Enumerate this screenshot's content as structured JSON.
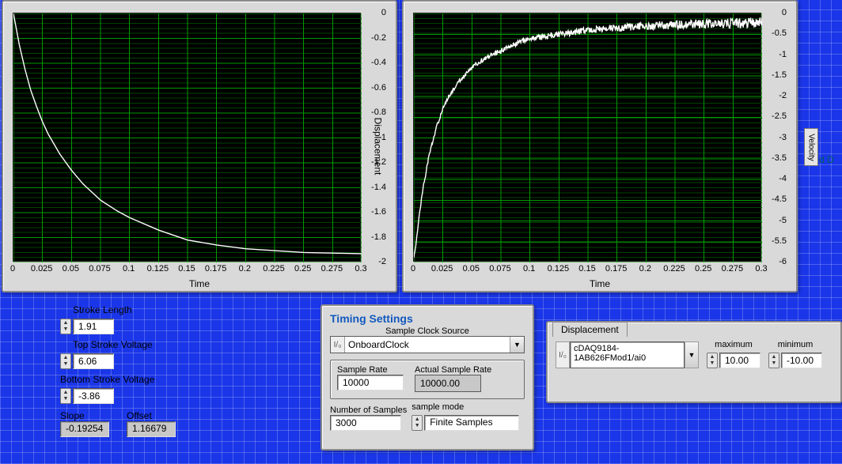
{
  "chart_data": [
    {
      "type": "line",
      "title": "",
      "xlabel": "Time",
      "ylabel": "Displacement",
      "xlim": [
        0,
        0.3
      ],
      "ylim": [
        -2,
        0
      ],
      "xticks": [
        0,
        0.025,
        0.05,
        0.075,
        0.1,
        0.125,
        0.15,
        0.175,
        0.2,
        0.225,
        0.25,
        0.275,
        0.3
      ],
      "yticks": [
        -2,
        -1.8,
        -1.6,
        -1.4,
        -1.2,
        -1,
        -0.8,
        -0.6,
        -0.4,
        -0.2,
        0
      ],
      "series": [
        {
          "name": "Displacement",
          "x": [
            0,
            0.005,
            0.01,
            0.015,
            0.02,
            0.025,
            0.03,
            0.04,
            0.05,
            0.06,
            0.075,
            0.09,
            0.1,
            0.125,
            0.15,
            0.175,
            0.2,
            0.25,
            0.3
          ],
          "y": [
            0,
            -0.25,
            -0.45,
            -0.62,
            -0.75,
            -0.87,
            -0.97,
            -1.13,
            -1.26,
            -1.37,
            -1.5,
            -1.59,
            -1.64,
            -1.74,
            -1.82,
            -1.86,
            -1.89,
            -1.92,
            -1.93
          ]
        }
      ]
    },
    {
      "type": "line",
      "title": "",
      "xlabel": "Time",
      "ylabel": "Velocity",
      "xlim": [
        0,
        0.3
      ],
      "ylim": [
        -6,
        0
      ],
      "xticks": [
        0,
        0.025,
        0.05,
        0.075,
        0.1,
        0.125,
        0.15,
        0.175,
        0.2,
        0.225,
        0.25,
        0.275,
        0.3
      ],
      "yticks": [
        -6,
        -5.5,
        -5,
        -4.5,
        -4,
        -3.5,
        -3,
        -2.5,
        -2,
        -1.5,
        -1,
        -0.5,
        0
      ],
      "series": [
        {
          "name": "Velocity",
          "x": [
            0,
            0.002,
            0.004,
            0.006,
            0.008,
            0.01,
            0.0125,
            0.015,
            0.02,
            0.025,
            0.03,
            0.04,
            0.05,
            0.06,
            0.075,
            0.09,
            0.1,
            0.125,
            0.15,
            0.175,
            0.2,
            0.25,
            0.3
          ],
          "y": [
            -5.9,
            -5.5,
            -5.0,
            -4.6,
            -4.2,
            -3.9,
            -3.5,
            -3.2,
            -2.7,
            -2.3,
            -2.0,
            -1.6,
            -1.3,
            -1.1,
            -0.9,
            -0.7,
            -0.6,
            -0.5,
            -0.4,
            -0.35,
            -0.3,
            -0.25,
            -0.22
          ],
          "noise": 0.25
        }
      ]
    }
  ],
  "controls": {
    "stroke_length_label": "Stroke Length",
    "stroke_length": "1.91",
    "top_stroke_voltage_label": "Top Stroke Voltage",
    "top_stroke_voltage": "6.06",
    "bottom_stroke_voltage_label": "Bottom Stroke Voltage",
    "bottom_stroke_voltage": "-3.86",
    "slope_label": "Slope",
    "slope": "-0.19254",
    "offset_label": "Offset",
    "offset": "1.16679"
  },
  "timing": {
    "title": "Timing Settings",
    "sample_clock_source_label": "Sample Clock Source",
    "sample_clock_source": "OnboardClock",
    "sample_rate_label": "Sample Rate",
    "sample_rate": "10000",
    "actual_sample_rate_label": "Actual Sample Rate",
    "actual_sample_rate": "10000.00",
    "number_of_samples_label": "Number of Samples",
    "number_of_samples": "3000",
    "sample_mode_label": "sample mode",
    "sample_mode": "Finite Samples"
  },
  "channel": {
    "tab": "Displacement",
    "io_prefix": "I/O",
    "physical_channel": "cDAQ9184-1AB626FMod1/ai0",
    "maximum_label": "maximum",
    "maximum": "10.00",
    "minimum_label": "minimum",
    "minimum": "-10.00"
  }
}
